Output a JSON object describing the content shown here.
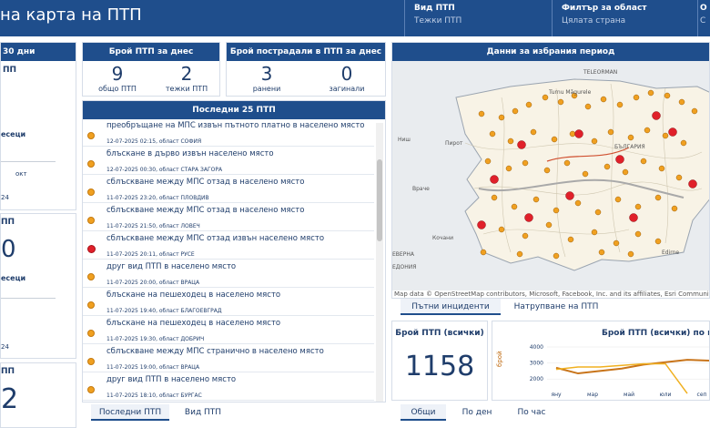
{
  "header": {
    "title": "на карта на ПТП",
    "filters": [
      {
        "label": "Вид ПТП",
        "value": "Тежки ПТП"
      },
      {
        "label": "Филтър за област",
        "value": "Цялата страна"
      },
      {
        "label": "О",
        "value": "С"
      }
    ]
  },
  "left": {
    "title": " 30 дни",
    "sub1": "ПП",
    "cut_labels": [
      "есеци",
      "окт",
      "24",
      "ПП",
      "0",
      "есеци",
      "24",
      "ПП",
      "2"
    ]
  },
  "today": {
    "count_title": "Брой ПТП за днес",
    "total": "9",
    "total_label": "общо ПТП",
    "heavy": "2",
    "heavy_label": "тежки ПТП",
    "victims_title": "Брой пострадали в ПТП за днес",
    "injured": "3",
    "injured_label": "ранени",
    "killed": "0",
    "killed_label": "загинали"
  },
  "list": {
    "title": "Последни 25 ПТП",
    "items": [
      {
        "text": "преобръщане на МПС извън пътното платно в населено място",
        "sub": "12-07-2025 02:15, област СОФИЯ",
        "color": "orange"
      },
      {
        "text": "блъскане в дърво извън населено място",
        "sub": "12-07-2025 00:30, област СТАРА ЗАГОРА",
        "color": "orange"
      },
      {
        "text": "сблъскване между МПС отзад в населено място",
        "sub": "11-07-2025 23:20, област ПЛОВДИВ",
        "color": "orange"
      },
      {
        "text": "сблъскване между МПС отзад в населено място",
        "sub": "11-07-2025 21:50, област ЛОВЕЧ",
        "color": "orange"
      },
      {
        "text": "сблъскване между МПС отзад извън населено място",
        "sub": "11-07-2025 20:11, област РУСЕ",
        "color": "red"
      },
      {
        "text": "друг вид ПТП в населено място",
        "sub": "11-07-2025 20:00, област ВРАЦА",
        "color": "orange"
      },
      {
        "text": "блъскане на пешеходец в населено място",
        "sub": "11-07-2025 19:40, област БЛАГОЕВГРАД",
        "color": "orange"
      },
      {
        "text": "блъскане на пешеходец в населено място",
        "sub": "11-07-2025 19:30, област ДОБРИЧ",
        "color": "orange"
      },
      {
        "text": "сблъскване между МПС странично в населено място",
        "sub": "11-07-2025 19:00, област ВРАЦА",
        "color": "orange"
      },
      {
        "text": "друг вид ПТП в населено място",
        "sub": "11-07-2025 18:10, област БУРГАС",
        "color": "orange"
      }
    ],
    "tabs": [
      "Последни ПТП",
      "Вид ПТП"
    ]
  },
  "map": {
    "title": "Данни за избрания период",
    "labels": [
      "TELEORMAN",
      "Turnu Măgurele",
      "Пирот",
      "Ниш",
      "Враче",
      "Кочани",
      "ЕВЕРНА",
      "ЕДОНИЯ",
      "Edirne",
      "БЪЛГАРИЯ"
    ],
    "attribution": "Map data © OpenStreetMap contributors, Microsoft, Facebook, Inc. and its affiliates, Esri Community"
  },
  "bottom": {
    "tabs": [
      "Пътни инциденти",
      "Натрупване на ПТП"
    ],
    "total_title": "Брой ПТП (всички)",
    "total_value": "1158",
    "chart_title": "Брой ПТП (всички) по мес",
    "sub_tabs": [
      "Общи",
      "По ден",
      "По час"
    ]
  },
  "chart_data": {
    "type": "line",
    "ylabel": "брой",
    "ylim": [
      0,
      4000
    ],
    "yticks": [
      "4000",
      "3000",
      "2000"
    ],
    "categories": [
      "яну",
      "мар",
      "май",
      "юли",
      "сеп"
    ],
    "series": [
      {
        "values": [
          2700,
          2350,
          2500,
          2650,
          2900,
          3050,
          3200,
          3150
        ]
      },
      {
        "values": [
          2600,
          2750,
          2750,
          2850,
          2950,
          2950,
          900
        ]
      }
    ]
  },
  "colors": {
    "header": "#1f4e8c",
    "accent": "#e89a20",
    "red": "#e0202a"
  }
}
